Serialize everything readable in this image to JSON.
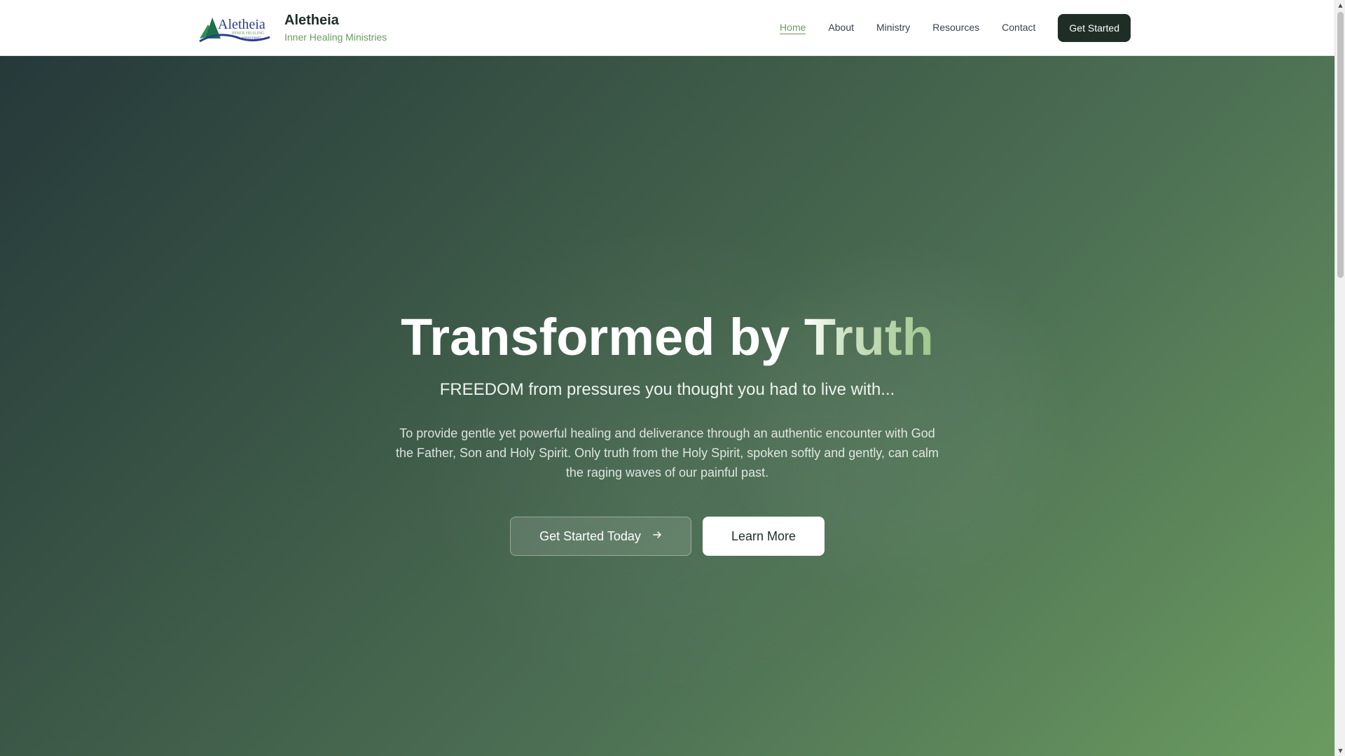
{
  "brand": {
    "name": "Aletheia",
    "tagline": "Inner Healing Ministries",
    "logo_text": "Aletheia",
    "logo_subtext_1": "INNER HEALING",
    "logo_subtext_2": "MINISTRIES"
  },
  "nav": {
    "items": [
      {
        "label": "Home",
        "active": true
      },
      {
        "label": "About",
        "active": false
      },
      {
        "label": "Ministry",
        "active": false
      },
      {
        "label": "Resources",
        "active": false
      },
      {
        "label": "Contact",
        "active": false
      }
    ],
    "cta_label": "Get Started"
  },
  "hero": {
    "title_plain": "Transformed by ",
    "title_accent": "Truth",
    "subtitle": "FREEDOM from pressures you thought you had to live with...",
    "body": "To provide gentle yet powerful healing and deliverance through an authentic encounter with God the Father, Son and Holy Spirit. Only truth from the Holy Spirit, spoken softly and gently, can calm the raging waves of our painful past.",
    "primary_button": "Get Started Today",
    "primary_button_icon": "arrow-right-icon",
    "secondary_button": "Learn More"
  },
  "scrollbar": {
    "up_glyph": "▲",
    "down_glyph": "▼"
  },
  "colors": {
    "brand_dark": "#1f2d27",
    "brand_green": "#6a9b5e",
    "hero_start": "#25393a",
    "hero_end": "#6b9b60"
  }
}
